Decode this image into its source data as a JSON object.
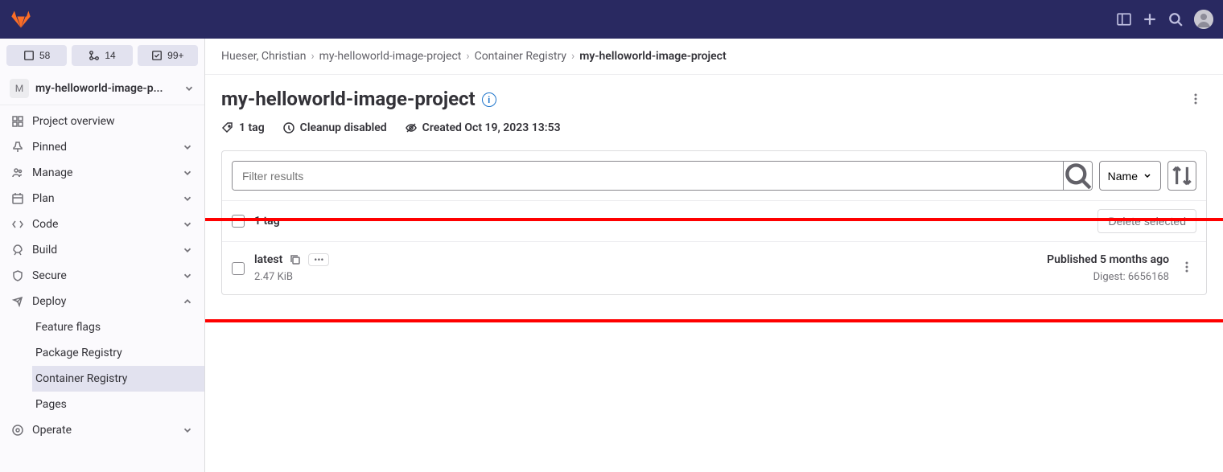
{
  "topbar": {
    "badges": {
      "issues": "58",
      "merge": "14",
      "todos": "99+"
    }
  },
  "project": {
    "avatar_letter": "M",
    "name": "my-helloworld-image-p..."
  },
  "sidebar": {
    "overview": "Project overview",
    "pinned": "Pinned",
    "manage": "Manage",
    "plan": "Plan",
    "code": "Code",
    "build": "Build",
    "secure": "Secure",
    "deploy": "Deploy",
    "deploy_sub": {
      "feature_flags": "Feature flags",
      "package_registry": "Package Registry",
      "container_registry": "Container Registry",
      "pages": "Pages"
    },
    "operate": "Operate"
  },
  "breadcrumbs": {
    "user": "Hueser, Christian",
    "project": "my-helloworld-image-project",
    "registry": "Container Registry",
    "current": "my-helloworld-image-project"
  },
  "page": {
    "title": "my-helloworld-image-project",
    "info_badge": "i",
    "meta": {
      "tags": "1 tag",
      "cleanup": "Cleanup disabled",
      "created": "Created Oct 19, 2023 13:53"
    }
  },
  "filter": {
    "placeholder": "Filter results",
    "sort_label": "Name"
  },
  "tags": {
    "header_label": "1 tag",
    "delete_label": "Delete selected",
    "rows": [
      {
        "name": "latest",
        "size": "2.47 KiB",
        "published": "Published 5 months ago",
        "digest": "Digest: 6656168"
      }
    ]
  }
}
